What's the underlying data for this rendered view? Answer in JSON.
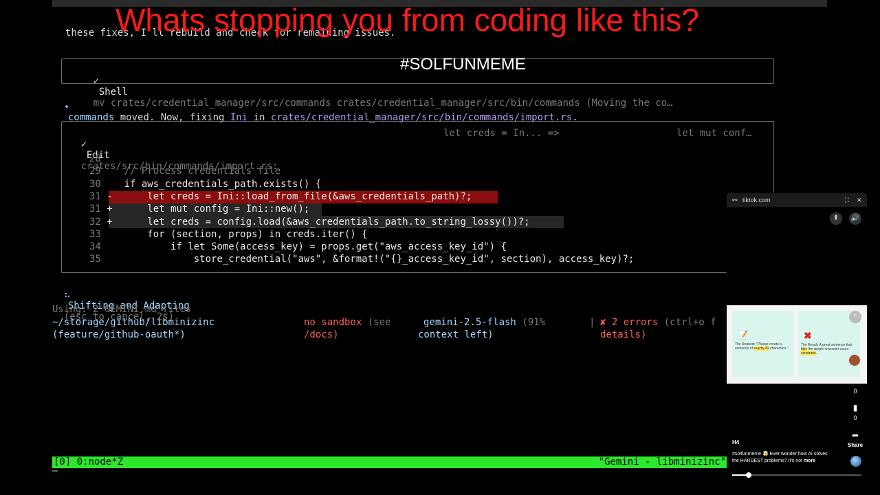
{
  "overlay": {
    "headline": "Whats stopping you from coding like this?",
    "hashtag": "#SOLFUNMEME"
  },
  "terminal": {
    "intro_line": "these fixes, I'll rebuild and check for remaining issues.",
    "shell": {
      "check": "✓",
      "label": "Shell",
      "command": "mv crates/credential_manager/src/commands crates/credential_manager/src/bin/commands (Moving the co…"
    },
    "status_msg": {
      "bullet": "✦",
      "pre1": "commands",
      "pre2": " moved. Now, fixing ",
      "code": "Ini",
      "mid": " in ",
      "path": "crates/credential_manager/src/bin/commands/import.rs",
      "end": "."
    },
    "edit": {
      "check": "✓",
      "label": "Edit",
      "file": "crates/src/bin/commands/import.rs:",
      "old": "let creds = In... =>",
      "new": "let mut conf…",
      "lines": [
        {
          "num": "28",
          "sign": "",
          "code": ""
        },
        {
          "num": "29",
          "sign": "",
          "code": "// Process credentials file"
        },
        {
          "num": "30",
          "sign": "",
          "code": "if aws_credentials_path.exists() {"
        },
        {
          "num": "31",
          "sign": "-",
          "code": "    let creds = Ini::load_from_file(&aws_credentials_path)?;"
        },
        {
          "num": "31",
          "sign": "+",
          "code": "    let mut config = Ini::new();"
        },
        {
          "num": "32",
          "sign": "+",
          "code": "    let creds = config.load(&aws_credentials_path.to_string_lossy())?;"
        },
        {
          "num": "33",
          "sign": "",
          "code": "    for (section, props) in creds.iter() {"
        },
        {
          "num": "34",
          "sign": "",
          "code": "        if let Some(access_key) = props.get(\"aws_access_key_id\") {"
        },
        {
          "num": "35",
          "sign": "",
          "code": "            store_credential(\"aws\", &format!(\"{}_access_key_id\", section), access_key)?;"
        }
      ]
    },
    "spinner": {
      "glyph": "⠦",
      "text": "Shifting and Adapting",
      "hint": "(esc to cancel, 2s)"
    },
    "footer": {
      "using": "Using: 2 GEMINI.md files",
      "path1": "~/storage/github/libminizinc",
      "path2": "(feature/github-oauth*)",
      "sandbox1": "no sandbox",
      "sandbox1b": "(see",
      "sandbox2": "/docs)",
      "model1": "gemini-2.5-flash",
      "model1b": "(91%",
      "model2": "context left)",
      "sep": "|",
      "err_icon": "✘",
      "errors1": "2 errors",
      "errors1b": "(ctrl+o f",
      "errors2": "details)"
    },
    "tmux": {
      "left": "[0] 0:node*Z",
      "right": "\"Gemini - libminizinc\""
    }
  },
  "tiktok": {
    "site": "tiktok.com",
    "card1_text_a": "The Request: \"Please create a sentence of ",
    "card1_hl": "exactly 82",
    "card1_text_b": " characters.\"",
    "card2_text_a": "The Result: A great sentence that ",
    "card2_hl": "fails",
    "card2_text_b": " the simple character-count ",
    "card2_hl2": "constraint",
    "card2_text_c": ".",
    "likes_count": "0",
    "saves_count": "0",
    "share_label": "Share",
    "author": "H4",
    "caption": "#solfunmeme 🤯 Ever wonder how AI solves the HARDEST problems? It's not",
    "more": "more"
  }
}
